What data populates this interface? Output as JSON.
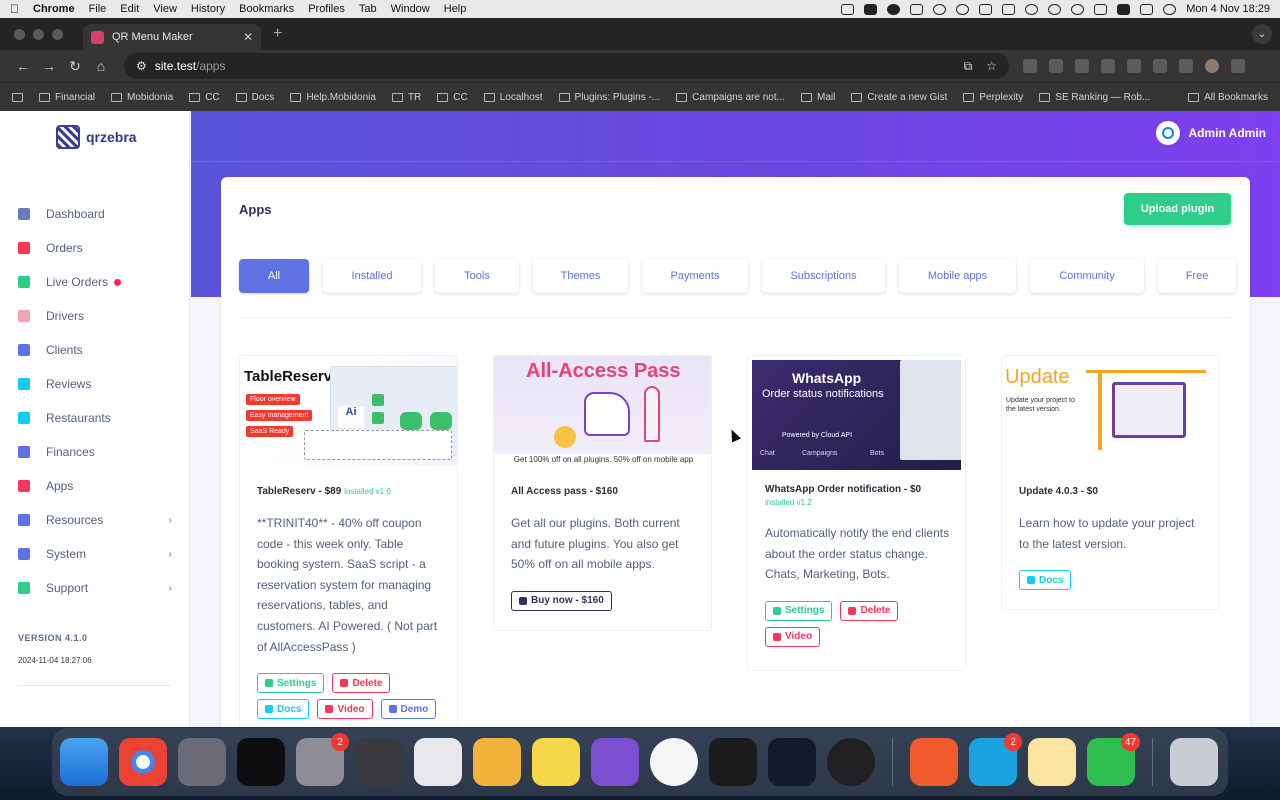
{
  "menubar": {
    "app": "Chrome",
    "items": [
      "File",
      "Edit",
      "View",
      "History",
      "Bookmarks",
      "Profiles",
      "Tab",
      "Window",
      "Help"
    ],
    "datetime": "Mon 4 Nov  18:29"
  },
  "browser": {
    "tab_title": "QR Menu Maker",
    "url_host": "site.test",
    "url_path": "/apps",
    "bookmarks": [
      "Financial",
      "Mobidonia",
      "CC",
      "Docs",
      "Help.Mobidonia",
      "TR",
      "CC",
      "Localhost",
      "Plugins: Plugins -...",
      "Campaigns are not...",
      "Mail",
      "Create a new Gist",
      "Perplexity",
      "SE Ranking — Rob..."
    ],
    "all_bookmarks": "All Bookmarks"
  },
  "sidebar": {
    "logo": "qrzebra",
    "items": [
      {
        "label": "Dashboard",
        "color": "#6b7bb8"
      },
      {
        "label": "Orders",
        "color": "#f5365c"
      },
      {
        "label": "Live Orders",
        "color": "#2dce89"
      },
      {
        "label": "Drivers",
        "color": "#f3a4b5"
      },
      {
        "label": "Clients",
        "color": "#5e72e4"
      },
      {
        "label": "Reviews",
        "color": "#11cdef"
      },
      {
        "label": "Restaurants",
        "color": "#11cdef"
      },
      {
        "label": "Finances",
        "color": "#5e72e4"
      },
      {
        "label": "Apps",
        "color": "#f5365c"
      },
      {
        "label": "Resources",
        "color": "#5e72e4"
      },
      {
        "label": "System",
        "color": "#5e72e4"
      },
      {
        "label": "Support",
        "color": "#2dce89"
      }
    ],
    "version": "VERSION 4.1.0",
    "version_date": "2024-11-04 18:27:06"
  },
  "header": {
    "user": "Admin Admin"
  },
  "apps": {
    "title": "Apps",
    "upload_label": "Upload plugin",
    "filters": [
      "All",
      "Installed",
      "Tools",
      "Themes",
      "Payments",
      "Subscriptions",
      "Mobile apps",
      "Community",
      "Free"
    ],
    "plugins": [
      {
        "name": "TableReserv - $89",
        "installed": "installed v1.0",
        "image_title": "TableReserve",
        "image_tags": [
          "Floor overview",
          "Easy management",
          "SaaS Ready"
        ],
        "description": "**TRINIT40** - 40% off coupon code - this week only. Table booking system. SaaS script - a reservation system for managing reservations, tables, and customers. AI Powered. ( Not part of AllAccessPass )",
        "buttons": [
          "Settings",
          "Delete",
          "Docs",
          "Video",
          "Demo"
        ]
      },
      {
        "name": "All Access pass - $160",
        "image_title": "All-Access Pass",
        "image_caption": "Get 100% off on all plugins. 50% off on mobile app",
        "description": "Get all our plugins. Both current and future plugins. You also get 50% off on all mobile apps.",
        "buttons": [
          "Buy now - $160"
        ]
      },
      {
        "name": "WhatsApp Order notification - $0",
        "installed": "installed v1.2",
        "image_title": "WhatsApp",
        "image_subtitle": "Order status notifications",
        "image_powered": "Powered by  Cloud API",
        "image_tabs": [
          "Chat",
          "Campaigns",
          "Bots"
        ],
        "description": "Automatically notify the end clients about the order status change. Chats, Marketing, Bots.",
        "buttons": [
          "Settings",
          "Delete",
          "Video"
        ]
      },
      {
        "name": "Update 4.0.3 - $0",
        "image_title": "Update",
        "image_text": "Update your project to the latest version.",
        "description": "Learn how to update your project to the latest version.",
        "buttons": [
          "Docs"
        ]
      }
    ]
  },
  "dock": {
    "badges": {
      "settings": "2",
      "skype": "2",
      "whatsapp": "47"
    }
  }
}
